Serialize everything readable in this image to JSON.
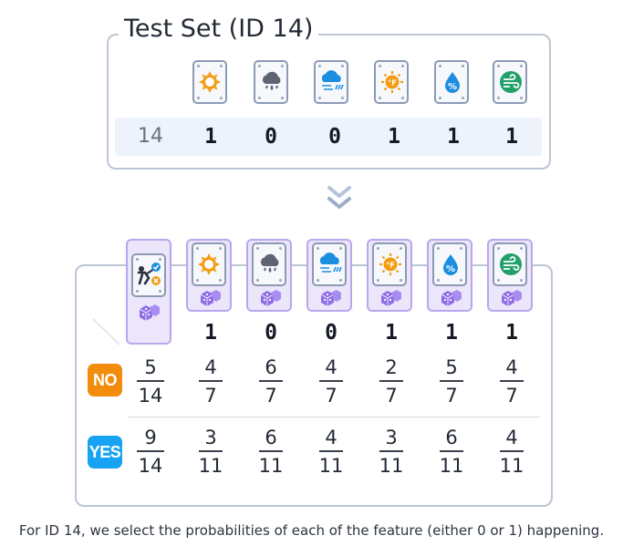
{
  "test_set": {
    "title": "Test Set (ID 14)",
    "id": "14",
    "features": [
      {
        "icon": "sun-icon",
        "value": "1"
      },
      {
        "icon": "cloud-rain-icon",
        "value": "0"
      },
      {
        "icon": "cloud-wind-icon",
        "value": "0"
      },
      {
        "icon": "hot-temperature-icon",
        "value": "1"
      },
      {
        "icon": "humidity-icon",
        "value": "1"
      },
      {
        "icon": "wind-icon",
        "value": "1"
      }
    ]
  },
  "probabilities": {
    "header_icon": "play-decision-icon",
    "values": [
      "1",
      "0",
      "0",
      "1",
      "1",
      "1"
    ],
    "rows": [
      {
        "label": "NO",
        "fractions": [
          {
            "num": "5",
            "den": "14"
          },
          {
            "num": "4",
            "den": "7"
          },
          {
            "num": "6",
            "den": "7"
          },
          {
            "num": "4",
            "den": "7"
          },
          {
            "num": "2",
            "den": "7"
          },
          {
            "num": "5",
            "den": "7"
          },
          {
            "num": "4",
            "den": "7"
          }
        ]
      },
      {
        "label": "YES",
        "fractions": [
          {
            "num": "9",
            "den": "14"
          },
          {
            "num": "3",
            "den": "11"
          },
          {
            "num": "6",
            "den": "11"
          },
          {
            "num": "4",
            "den": "11"
          },
          {
            "num": "3",
            "den": "11"
          },
          {
            "num": "6",
            "den": "11"
          },
          {
            "num": "4",
            "den": "11"
          }
        ]
      }
    ]
  },
  "caption": "For ID 14, we select the probabilities of each of the feature (either 0 or 1) happening.",
  "colors": {
    "no_badge": "#f28c0c",
    "yes_badge": "#17a3f1",
    "column_highlight": "#ece6fb",
    "dice": "#8f6ee6"
  }
}
